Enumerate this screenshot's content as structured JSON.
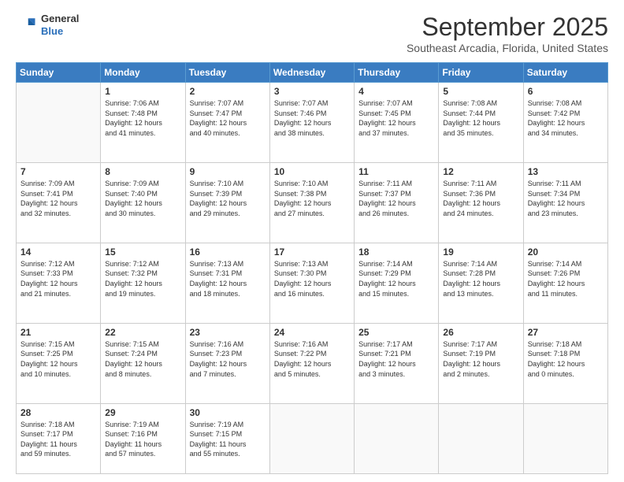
{
  "header": {
    "logo": {
      "line1": "General",
      "line2": "Blue"
    },
    "title": "September 2025",
    "location": "Southeast Arcadia, Florida, United States"
  },
  "weekdays": [
    "Sunday",
    "Monday",
    "Tuesday",
    "Wednesday",
    "Thursday",
    "Friday",
    "Saturday"
  ],
  "weeks": [
    [
      null,
      {
        "day": 1,
        "sunrise": "7:06 AM",
        "sunset": "7:48 PM",
        "daylight": "12 hours and 41 minutes."
      },
      {
        "day": 2,
        "sunrise": "7:07 AM",
        "sunset": "7:47 PM",
        "daylight": "12 hours and 40 minutes."
      },
      {
        "day": 3,
        "sunrise": "7:07 AM",
        "sunset": "7:46 PM",
        "daylight": "12 hours and 38 minutes."
      },
      {
        "day": 4,
        "sunrise": "7:07 AM",
        "sunset": "7:45 PM",
        "daylight": "12 hours and 37 minutes."
      },
      {
        "day": 5,
        "sunrise": "7:08 AM",
        "sunset": "7:44 PM",
        "daylight": "12 hours and 35 minutes."
      },
      {
        "day": 6,
        "sunrise": "7:08 AM",
        "sunset": "7:42 PM",
        "daylight": "12 hours and 34 minutes."
      }
    ],
    [
      {
        "day": 7,
        "sunrise": "7:09 AM",
        "sunset": "7:41 PM",
        "daylight": "12 hours and 32 minutes."
      },
      {
        "day": 8,
        "sunrise": "7:09 AM",
        "sunset": "7:40 PM",
        "daylight": "12 hours and 30 minutes."
      },
      {
        "day": 9,
        "sunrise": "7:10 AM",
        "sunset": "7:39 PM",
        "daylight": "12 hours and 29 minutes."
      },
      {
        "day": 10,
        "sunrise": "7:10 AM",
        "sunset": "7:38 PM",
        "daylight": "12 hours and 27 minutes."
      },
      {
        "day": 11,
        "sunrise": "7:11 AM",
        "sunset": "7:37 PM",
        "daylight": "12 hours and 26 minutes."
      },
      {
        "day": 12,
        "sunrise": "7:11 AM",
        "sunset": "7:36 PM",
        "daylight": "12 hours and 24 minutes."
      },
      {
        "day": 13,
        "sunrise": "7:11 AM",
        "sunset": "7:34 PM",
        "daylight": "12 hours and 23 minutes."
      }
    ],
    [
      {
        "day": 14,
        "sunrise": "7:12 AM",
        "sunset": "7:33 PM",
        "daylight": "12 hours and 21 minutes."
      },
      {
        "day": 15,
        "sunrise": "7:12 AM",
        "sunset": "7:32 PM",
        "daylight": "12 hours and 19 minutes."
      },
      {
        "day": 16,
        "sunrise": "7:13 AM",
        "sunset": "7:31 PM",
        "daylight": "12 hours and 18 minutes."
      },
      {
        "day": 17,
        "sunrise": "7:13 AM",
        "sunset": "7:30 PM",
        "daylight": "12 hours and 16 minutes."
      },
      {
        "day": 18,
        "sunrise": "7:14 AM",
        "sunset": "7:29 PM",
        "daylight": "12 hours and 15 minutes."
      },
      {
        "day": 19,
        "sunrise": "7:14 AM",
        "sunset": "7:28 PM",
        "daylight": "12 hours and 13 minutes."
      },
      {
        "day": 20,
        "sunrise": "7:14 AM",
        "sunset": "7:26 PM",
        "daylight": "12 hours and 11 minutes."
      }
    ],
    [
      {
        "day": 21,
        "sunrise": "7:15 AM",
        "sunset": "7:25 PM",
        "daylight": "12 hours and 10 minutes."
      },
      {
        "day": 22,
        "sunrise": "7:15 AM",
        "sunset": "7:24 PM",
        "daylight": "12 hours and 8 minutes."
      },
      {
        "day": 23,
        "sunrise": "7:16 AM",
        "sunset": "7:23 PM",
        "daylight": "12 hours and 7 minutes."
      },
      {
        "day": 24,
        "sunrise": "7:16 AM",
        "sunset": "7:22 PM",
        "daylight": "12 hours and 5 minutes."
      },
      {
        "day": 25,
        "sunrise": "7:17 AM",
        "sunset": "7:21 PM",
        "daylight": "12 hours and 3 minutes."
      },
      {
        "day": 26,
        "sunrise": "7:17 AM",
        "sunset": "7:19 PM",
        "daylight": "12 hours and 2 minutes."
      },
      {
        "day": 27,
        "sunrise": "7:18 AM",
        "sunset": "7:18 PM",
        "daylight": "12 hours and 0 minutes."
      }
    ],
    [
      {
        "day": 28,
        "sunrise": "7:18 AM",
        "sunset": "7:17 PM",
        "daylight": "11 hours and 59 minutes."
      },
      {
        "day": 29,
        "sunrise": "7:19 AM",
        "sunset": "7:16 PM",
        "daylight": "11 hours and 57 minutes."
      },
      {
        "day": 30,
        "sunrise": "7:19 AM",
        "sunset": "7:15 PM",
        "daylight": "11 hours and 55 minutes."
      },
      null,
      null,
      null,
      null
    ]
  ],
  "labels": {
    "sunrise": "Sunrise:",
    "sunset": "Sunset:",
    "daylight": "Daylight:"
  }
}
